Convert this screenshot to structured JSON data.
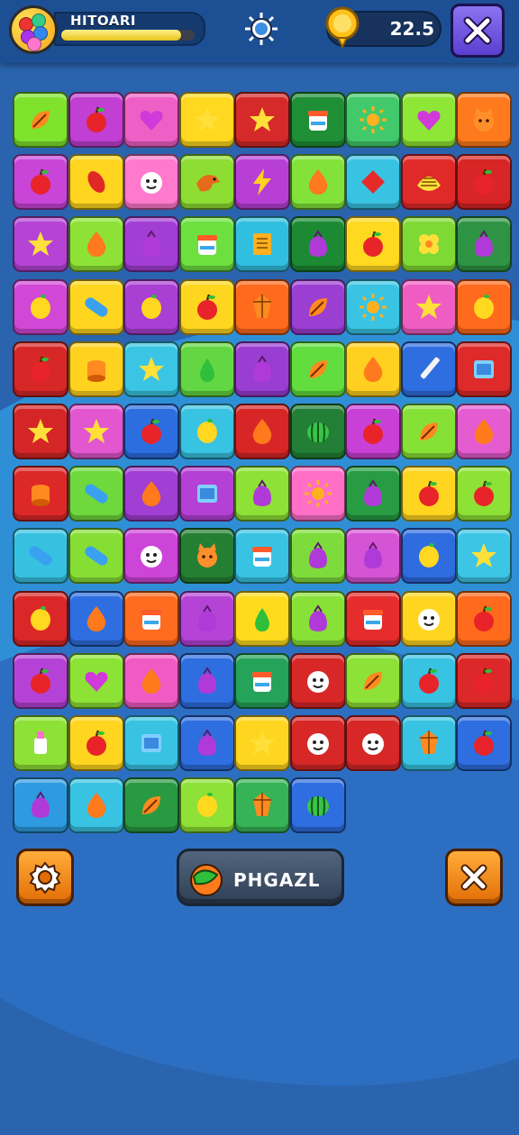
{
  "header": {
    "player_name": "HITOARI",
    "xp_progress": 0.9,
    "coin_amount": "22.5",
    "icons": {
      "avatar": "candy-cluster",
      "settings": "sun-gear-icon",
      "coin": "gold-coin-icon",
      "close": "close-icon"
    }
  },
  "board": {
    "rows": [
      [
        [
          "#7fe22c",
          "leaf"
        ],
        [
          "#c13fd2",
          "apple"
        ],
        [
          "#ef5fc6",
          "heart"
        ],
        [
          "#ffd81f",
          "star"
        ],
        [
          "#d62929",
          "star"
        ],
        [
          "#1f8f36",
          "jar"
        ],
        [
          "#41c96b",
          "sun"
        ],
        [
          "#8ee636",
          "heart"
        ],
        [
          "#ff7a1c",
          "cat"
        ]
      ],
      [
        [
          "#c845d8",
          "apple"
        ],
        [
          "#ffd51f",
          "bean"
        ],
        [
          "#ff79cc",
          "face"
        ],
        [
          "#8ddd33",
          "bird"
        ],
        [
          "#b83fd6",
          "bolt"
        ],
        [
          "#82e23a",
          "drop"
        ],
        [
          "#39c3e3",
          "diamond"
        ],
        [
          "#e02a2a",
          "shell"
        ],
        [
          "#d82525",
          "apple"
        ]
      ],
      [
        [
          "#b544d6",
          "star"
        ],
        [
          "#8ee236",
          "drop"
        ],
        [
          "#a33ed4",
          "bag"
        ],
        [
          "#6de040",
          "jar"
        ],
        [
          "#31bfe0",
          "book"
        ],
        [
          "#1c8a33",
          "bag"
        ],
        [
          "#ffd920",
          "apple"
        ],
        [
          "#7fd934",
          "flower"
        ],
        [
          "#2e9444",
          "bag"
        ]
      ],
      [
        [
          "#d148d6",
          "lemon"
        ],
        [
          "#ffd61f",
          "pill"
        ],
        [
          "#a940d4",
          "lemon"
        ],
        [
          "#ffd61f",
          "apple"
        ],
        [
          "#ff6a1c",
          "gem"
        ],
        [
          "#9b3ed2",
          "leaf"
        ],
        [
          "#39c4e4",
          "sun"
        ],
        [
          "#ef5dc3",
          "star"
        ],
        [
          "#ff6a1c",
          "lemon"
        ]
      ],
      [
        [
          "#d72727",
          "apple"
        ],
        [
          "#ffd21f",
          "drum"
        ],
        [
          "#39c5e3",
          "star"
        ],
        [
          "#63d743",
          "pear"
        ],
        [
          "#9a3dd1",
          "bag"
        ],
        [
          "#61dd3f",
          "leaf"
        ],
        [
          "#ffd01f",
          "drop"
        ],
        [
          "#2f6ee0",
          "pen"
        ],
        [
          "#df2a2a",
          "card"
        ]
      ],
      [
        [
          "#d42626",
          "star"
        ],
        [
          "#e257d0",
          "star"
        ],
        [
          "#2c6ee0",
          "apple"
        ],
        [
          "#38c3e2",
          "lemon"
        ],
        [
          "#d82626",
          "drop"
        ],
        [
          "#227f35",
          "melon"
        ],
        [
          "#c840d5",
          "apple"
        ],
        [
          "#86e136",
          "leaf"
        ],
        [
          "#e45cd0",
          "drop"
        ]
      ],
      [
        [
          "#dd2828",
          "drum"
        ],
        [
          "#6fd83c",
          "pill"
        ],
        [
          "#a13ed3",
          "drop"
        ],
        [
          "#b440d5",
          "card"
        ],
        [
          "#8ee135",
          "bag"
        ],
        [
          "#ff6fc8",
          "sun"
        ],
        [
          "#279c42",
          "bag"
        ],
        [
          "#ffd51f",
          "apple"
        ],
        [
          "#8ee135",
          "apple"
        ]
      ],
      [
        [
          "#36c1e1",
          "pill"
        ],
        [
          "#86de35",
          "pill"
        ],
        [
          "#cd45d8",
          "face"
        ],
        [
          "#257f33",
          "cat"
        ],
        [
          "#38c3e3",
          "jar"
        ],
        [
          "#7ddc3c",
          "bag"
        ],
        [
          "#d553d5",
          "bag"
        ],
        [
          "#2f6ce0",
          "lemon"
        ],
        [
          "#3dc5e6",
          "star"
        ]
      ],
      [
        [
          "#db2727",
          "lemon"
        ],
        [
          "#2f6ee0",
          "drop"
        ],
        [
          "#ff6b1f",
          "jar"
        ],
        [
          "#b443d6",
          "bag"
        ],
        [
          "#ffdb1f",
          "pear"
        ],
        [
          "#88e136",
          "bag"
        ],
        [
          "#e62c2c",
          "jar"
        ],
        [
          "#ffd51f",
          "face"
        ],
        [
          "#ff6a1c",
          "apple"
        ]
      ],
      [
        [
          "#b542d6",
          "apple"
        ],
        [
          "#8de236",
          "heart"
        ],
        [
          "#ef5bc3",
          "drop"
        ],
        [
          "#2e6ee0",
          "bag"
        ],
        [
          "#26a35a",
          "jar"
        ],
        [
          "#d72727",
          "face"
        ],
        [
          "#8ee136",
          "leaf"
        ],
        [
          "#38c3e3",
          "apple"
        ],
        [
          "#dc2828",
          "apple"
        ]
      ],
      [
        [
          "#8ee136",
          "bottle"
        ],
        [
          "#ffd61f",
          "apple"
        ],
        [
          "#38c3e3",
          "card"
        ],
        [
          "#2e6ee0",
          "bag"
        ],
        [
          "#ffd61f",
          "star"
        ],
        [
          "#d72727",
          "face"
        ],
        [
          "#d72727",
          "face"
        ],
        [
          "#38c3e3",
          "gem"
        ],
        [
          "#2e6ee0",
          "apple"
        ]
      ],
      [
        [
          "#2e9be0",
          "bag"
        ],
        [
          "#38c3e3",
          "drop"
        ],
        [
          "#2a9a42",
          "leaf"
        ],
        [
          "#8ee136",
          "lemon"
        ],
        [
          "#36b257",
          "gem"
        ],
        [
          "#2e6ee0",
          "melon"
        ]
      ]
    ]
  },
  "footer": {
    "hint_label": "PHGAZL",
    "icons": {
      "left": "gear-icon",
      "hint": "fruit-icon",
      "right": "close-icon"
    }
  }
}
